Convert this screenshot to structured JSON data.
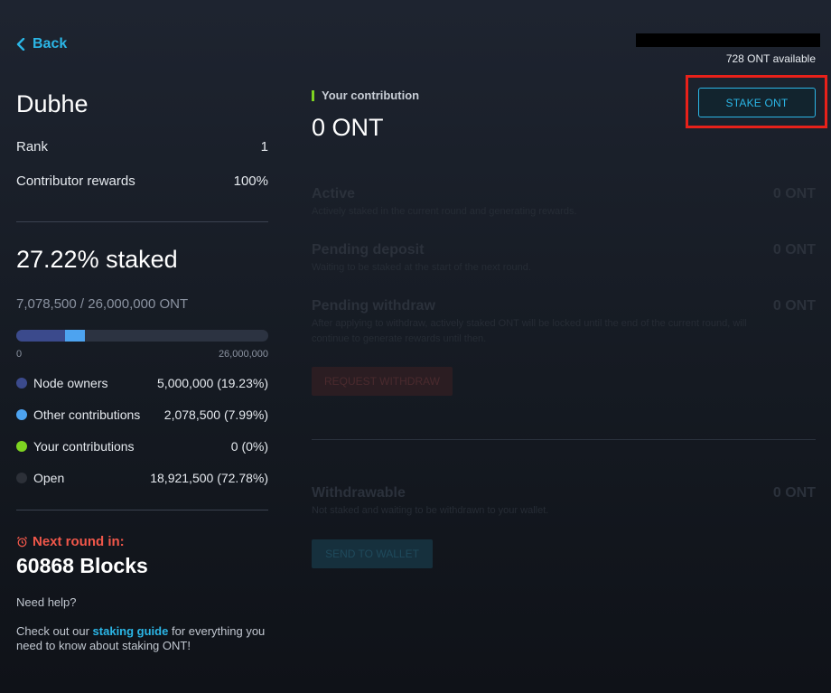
{
  "nav": {
    "back_label": "Back"
  },
  "wallet": {
    "available": "728 ONT available"
  },
  "node": {
    "name": "Dubhe",
    "rank_label": "Rank",
    "rank_value": "1",
    "rewards_label": "Contributor rewards",
    "rewards_value": "100%"
  },
  "stake": {
    "percent_text": "27.22% staked",
    "amount_text": "7,078,500 / 26,000,000 ONT",
    "bar_min": "0",
    "bar_max": "26,000,000",
    "bar_fractions": {
      "node_owners": 0.1923,
      "other": 0.0799,
      "yours": 0.0
    },
    "legend": [
      {
        "name": "Node owners",
        "value": "5,000,000 (19.23%)",
        "color": "#3b4a8c"
      },
      {
        "name": "Other contributions",
        "value": "2,078,500 (7.99%)",
        "color": "#4da3f0"
      },
      {
        "name": "Your contributions",
        "value": "0 (0%)",
        "color": "#7ed321"
      },
      {
        "name": "Open",
        "value": "18,921,500 (72.78%)",
        "color": "#2c3038"
      }
    ]
  },
  "round": {
    "label": "Next round in:",
    "blocks": "60868 Blocks",
    "help": "Need help?",
    "guide_prefix": "Check out our ",
    "guide_link": "staking guide",
    "guide_suffix": " for everything you need to know about staking ONT!"
  },
  "contribution": {
    "label": "Your contribution",
    "value": "0 ONT",
    "stake_button": "STAKE ONT"
  },
  "rows": {
    "active": {
      "title": "Active",
      "desc": "Actively staked in the current round and generating rewards.",
      "value": "0 ONT"
    },
    "pending_deposit": {
      "title": "Pending deposit",
      "desc": "Waiting to be staked at the start of the next round.",
      "value": "0 ONT"
    },
    "pending_withdraw": {
      "title": "Pending withdraw",
      "desc": "After applying to withdraw, actively staked ONT will be locked until the end of the current round, will continue to generate rewards until then.",
      "value": "0 ONT"
    },
    "request_withdraw_button": "REQUEST WITHDRAW",
    "withdrawable": {
      "title": "Withdrawable",
      "desc": "Not staked and waiting to be withdrawn to your wallet.",
      "value": "0 ONT"
    },
    "send_button": "SEND TO WALLET"
  }
}
